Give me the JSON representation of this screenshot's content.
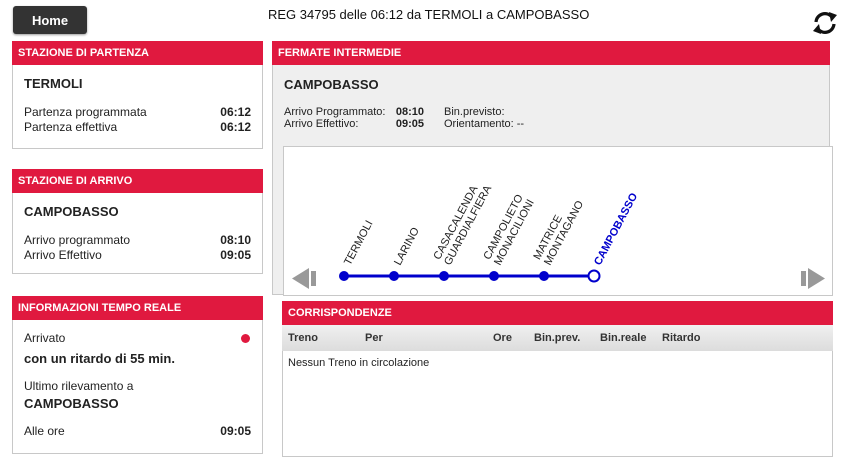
{
  "header": {
    "home_label": "Home",
    "title": "REG 34795 delle 06:12 da TERMOLI a CAMPOBASSO"
  },
  "departure": {
    "header": "STAZIONE DI PARTENZA",
    "station": "TERMOLI",
    "rows": [
      {
        "label": "Partenza programmata",
        "value": "06:12"
      },
      {
        "label": "Partenza effettiva",
        "value": "06:12"
      }
    ]
  },
  "arrival": {
    "header": "STAZIONE DI ARRIVO",
    "station": "CAMPOBASSO",
    "rows": [
      {
        "label": "Arrivo programmato",
        "value": "08:10"
      },
      {
        "label": "Arrivo Effettivo",
        "value": "09:05"
      }
    ]
  },
  "realtime": {
    "header": "INFORMAZIONI TEMPO REALE",
    "status": "Arrivato",
    "delay": "con un ritardo di 55 min.",
    "last_label": "Ultimo rilevamento a",
    "last_station": "CAMPOBASSO",
    "time_label": "Alle ore",
    "time_value": "09:05",
    "status_color": "#e0193f"
  },
  "intermediate": {
    "header": "FERMATE INTERMEDIE",
    "station": "CAMPOBASSO",
    "arr_prog_label": "Arrivo Programmato:",
    "arr_prog_value": "08:10",
    "arr_eff_label": "Arrivo Effettivo:",
    "arr_eff_value": "09:05",
    "bin_label": "Bin.previsto:",
    "orient_label": "Orientamento: --",
    "stops": [
      {
        "line1": "TERMOLI",
        "line2": ""
      },
      {
        "line1": "LARINO",
        "line2": ""
      },
      {
        "line1": "CASACALENDA",
        "line2": "GUARDIALFIERA"
      },
      {
        "line1": "CAMPOLIETO",
        "line2": "MONACILIONI"
      },
      {
        "line1": "MATRICE",
        "line2": "MONTAGANO"
      },
      {
        "line1": "CAMPOBASSO",
        "line2": ""
      }
    ],
    "route_color": "#0000cc",
    "left_arrow_icon": "arrow-left-icon",
    "right_arrow_icon": "arrow-right-icon"
  },
  "connections": {
    "header": "CORRISPONDENZE",
    "columns": [
      "Treno",
      "Per",
      "Ore",
      "Bin.prev.",
      "Bin.reale",
      "Ritardo"
    ],
    "empty_text": "Nessun Treno in circolazione"
  },
  "brand_color": "#e0193f",
  "refresh_icon": "refresh-icon"
}
